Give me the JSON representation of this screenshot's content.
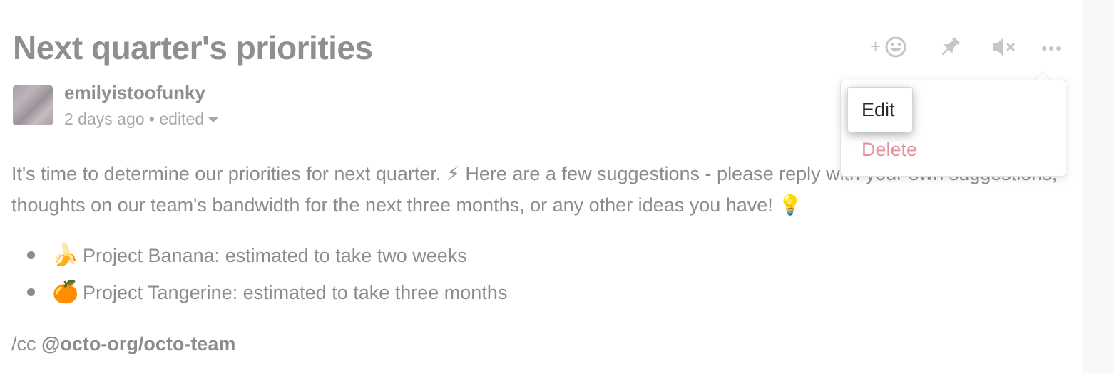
{
  "discussion": {
    "title": "Next quarter's priorities",
    "author": "emilyistoofunky",
    "timestamp": "2 days ago",
    "separator": "•",
    "edited_label": "edited",
    "body_line": "It's time to determine our priorities for next quarter. ⚡ Here are a few suggestions - please reply with your own suggestions, thoughts on our team's bandwidth for the next three months, or any other ideas you have! 💡",
    "list": [
      {
        "emoji": "🍌",
        "text": "Project Banana: estimated to take two weeks"
      },
      {
        "emoji": "🍊",
        "text": "Project Tangerine: estimated to take three months"
      }
    ],
    "cc_prefix": "/cc",
    "cc_team": "@octo-org/octo-team"
  },
  "toolbar": {
    "icons": [
      "add-reaction-icon",
      "pin-icon",
      "mute-icon",
      "more-options-icon"
    ]
  },
  "menu": {
    "edit_label": "Edit",
    "delete_label": "Delete",
    "delete_color": "#e3929a"
  }
}
